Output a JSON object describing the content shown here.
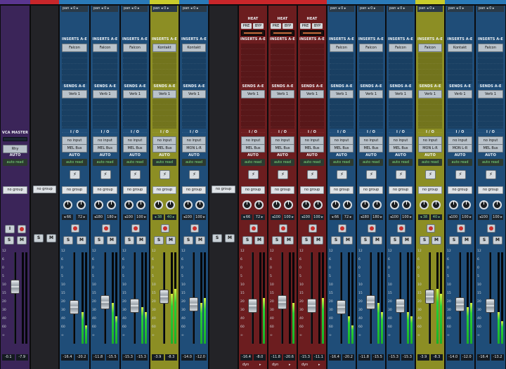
{
  "app": {
    "name": "Pro Tools Mix Window"
  },
  "colors": {
    "blue": "#1d4a72",
    "yellow": "#888a22",
    "red": "#6a1c1c",
    "purple": "#3a2458",
    "gray": "#2b2b2f",
    "green_meter": "#28d236"
  },
  "strips": [
    {
      "type": "vca",
      "color": "purple",
      "header": "",
      "vca_label": "VCA MASTER",
      "alloc": "Rhy",
      "auto_label": "AUTO",
      "auto_mode": "auto read",
      "group": "no group",
      "solo": "S",
      "mute": "M",
      "vol_l": "-0.1",
      "vol_r": "-7.9",
      "fader_pct": 0.35,
      "meter_l": 0,
      "meter_r": 0
    },
    {
      "type": "aux",
      "color": "red_top",
      "header": "",
      "group": "no group",
      "solo": "S",
      "mute": "M",
      "fader_pct": null,
      "meter_l": 0,
      "meter_r": 0
    },
    {
      "type": "track",
      "color": "blue",
      "header": "pan ◂ 0 ▸",
      "insert": "Falcon",
      "send": "Verb 1",
      "io_in": "no input",
      "io_out": "MEL Bus",
      "auto_mode": "auto read",
      "group": "no group",
      "pan_l": "◂ 66",
      "pan_r": "72 ▸",
      "vol_l": "-16.4",
      "vol_r": "-20.2",
      "fader_pct": 0.62,
      "meter_l": 0.35,
      "meter_r": 0.2
    },
    {
      "type": "track",
      "color": "blue",
      "header": "pan ◂ 0 ▸",
      "insert": "Falcon",
      "send": "Verb 1",
      "io_in": "no input",
      "io_out": "MEL Bus",
      "auto_mode": "auto read",
      "group": "no group",
      "pan_l": "◂180",
      "pan_r": "180 ▸",
      "vol_l": "-11.8",
      "vol_r": "-15.5",
      "fader_pct": 0.55,
      "meter_l": 0.45,
      "meter_r": 0.3
    },
    {
      "type": "track",
      "color": "blue",
      "header": "pan ◂ 0 ▸",
      "insert": "Falcon",
      "send": "Verb 1",
      "io_in": "no input",
      "io_out": "MEL Bus",
      "auto_mode": "auto read",
      "group": "no group",
      "pan_l": "◂100",
      "pan_r": "100 ▸",
      "vol_l": "-15.3",
      "vol_r": "-15.3",
      "fader_pct": 0.6,
      "meter_l": 0.4,
      "meter_r": 0.35
    },
    {
      "type": "track",
      "color": "yellow",
      "header": "pan ◂ 0 ▸",
      "insert": "Kontakt",
      "send": "Verb 1",
      "io_in": "no input",
      "io_out": "MEL Bus",
      "auto_mode": "auto read",
      "group": "no group",
      "pan_l": "◂ 38",
      "pan_r": "40 ▸",
      "vol_l": "-3.9",
      "vol_r": "-8.3",
      "fader_pct": 0.48,
      "meter_l": 0.55,
      "meter_r": 0.6
    },
    {
      "type": "track",
      "color": "blue",
      "header": "pan ◂ 0 ▸",
      "insert": "Kontakt",
      "send": "Verb 1",
      "io_in": "no input",
      "io_out": "MON L-R",
      "auto_mode": "auto read",
      "group": "no group",
      "pan_l": "◂100",
      "pan_r": "100 ▸",
      "vol_l": "-14.0",
      "vol_r": "-12.0",
      "fader_pct": 0.58,
      "meter_l": 0.45,
      "meter_r": 0.5
    },
    {
      "type": "aux",
      "color": "red_top",
      "header": "",
      "group": "no group",
      "solo": "S",
      "mute": "M",
      "fader_pct": null,
      "meter_l": 0,
      "meter_r": 0
    },
    {
      "type": "redtrack",
      "color": "red",
      "header": "",
      "heat": "HEAT",
      "pre": "PRE",
      "byp": "BYP",
      "send": "Verb 1",
      "io_in": "no input",
      "io_out": "MEL Bus",
      "auto_mode": "auto read",
      "group": "no group",
      "pan_l": "◂ 66",
      "pan_r": "72 ▸",
      "vol_l": "-16.4",
      "vol_r": "-8.0",
      "fader_pct": 0.6,
      "meter_l": 0.0,
      "meter_r": 0.5,
      "dyn": "dyn"
    },
    {
      "type": "redtrack",
      "color": "red",
      "header": "",
      "heat": "HEAT",
      "pre": "PRE",
      "byp": "BYP",
      "send": "Verb 1",
      "io_in": "no input",
      "io_out": "MEL Bus",
      "auto_mode": "auto read",
      "group": "no group",
      "pan_l": "◂100",
      "pan_r": "100 ▸",
      "vol_l": "-11.8",
      "vol_r": "-20.6",
      "fader_pct": 0.55,
      "meter_l": 0.0,
      "meter_r": 0.45,
      "dyn": "dyn"
    },
    {
      "type": "redtrack",
      "color": "red",
      "header": "",
      "heat": "HEAT",
      "pre": "PRE",
      "byp": "BYP",
      "send": "Verb 1",
      "io_in": "no input",
      "io_out": "MEL Bus",
      "auto_mode": "auto read",
      "group": "no group",
      "pan_l": "◂100",
      "pan_r": "100 ▸",
      "vol_l": "-15.3",
      "vol_r": "-11.1",
      "fader_pct": 0.6,
      "meter_l": 0.0,
      "meter_r": 0.5,
      "dyn": "dyn"
    },
    {
      "type": "track",
      "color": "blue",
      "header": "pan ◂ 0 ▸",
      "insert": "Falcon",
      "send": "Verb 1",
      "io_in": "no input",
      "io_out": "MEL Bus",
      "auto_mode": "auto read",
      "group": "no group",
      "pan_l": "◂ 66",
      "pan_r": "72 ▸",
      "vol_l": "-16.4",
      "vol_r": "-20.2",
      "fader_pct": 0.62,
      "meter_l": 0.3,
      "meter_r": 0.2
    },
    {
      "type": "track",
      "color": "blue",
      "header": "pan ◂ 0 ▸",
      "insert": "Falcon",
      "send": "Verb 1",
      "io_in": "no input",
      "io_out": "MEL Bus",
      "auto_mode": "auto read",
      "group": "no group",
      "pan_l": "◂180",
      "pan_r": "180 ▸",
      "vol_l": "-11.8",
      "vol_r": "-15.5",
      "fader_pct": 0.55,
      "meter_l": 0.45,
      "meter_r": 0.35
    },
    {
      "type": "track",
      "color": "blue",
      "header": "pan ◂ 0 ▸",
      "insert": "Falcon",
      "send": "Verb 1",
      "io_in": "no input",
      "io_out": "MEL Bus",
      "auto_mode": "auto read",
      "group": "no group",
      "pan_l": "◂100",
      "pan_r": "100 ▸",
      "vol_l": "-15.3",
      "vol_r": "-15.3",
      "fader_pct": 0.6,
      "meter_l": 0.35,
      "meter_r": 0.3
    },
    {
      "type": "track",
      "color": "yellow",
      "header": "pan ◂ 0 ▸",
      "insert": "Falcon",
      "send": "Verb 1",
      "io_in": "no input",
      "io_out": "MON L-R",
      "auto_mode": "auto read",
      "group": "no group",
      "pan_l": "◂ 38",
      "pan_r": "40 ▸",
      "vol_l": "-3.9",
      "vol_r": "-8.3",
      "fader_pct": 0.48,
      "meter_l": 0.6,
      "meter_r": 0.55
    },
    {
      "type": "track",
      "color": "blue",
      "header": "pan ◂ 0 ▸",
      "insert": "Kontakt",
      "send": "Verb 1",
      "io_in": "no input",
      "io_out": "MON L-R",
      "auto_mode": "auto read",
      "group": "no group",
      "pan_l": "◂100",
      "pan_r": "100 ▸",
      "vol_l": "-14.0",
      "vol_r": "-12.0",
      "fader_pct": 0.58,
      "meter_l": 0.4,
      "meter_r": 0.45
    },
    {
      "type": "track",
      "color": "blue",
      "header": "pan ◂ 0 ▸",
      "insert": "Falcon",
      "send": "Verb 1",
      "io_in": "no input",
      "io_out": "MEL Bus",
      "auto_mode": "auto read",
      "group": "no group",
      "pan_l": "◂100",
      "pan_r": "100 ▸",
      "vol_l": "-16.4",
      "vol_r": "-13.2",
      "fader_pct": 0.6,
      "meter_l": 0.35,
      "meter_r": 0.25
    }
  ],
  "labels": {
    "inserts": "INSERTS A-E",
    "sends": "SENDS A-E",
    "io": "I / O",
    "auto": "AUTO",
    "input_btn": "I",
    "solo": "S",
    "mute": "M",
    "bolt": "⚡"
  },
  "scale_marks": [
    "12",
    "6",
    "0",
    "5",
    "10",
    "15",
    "20",
    "30",
    "40",
    "60",
    "∞"
  ]
}
